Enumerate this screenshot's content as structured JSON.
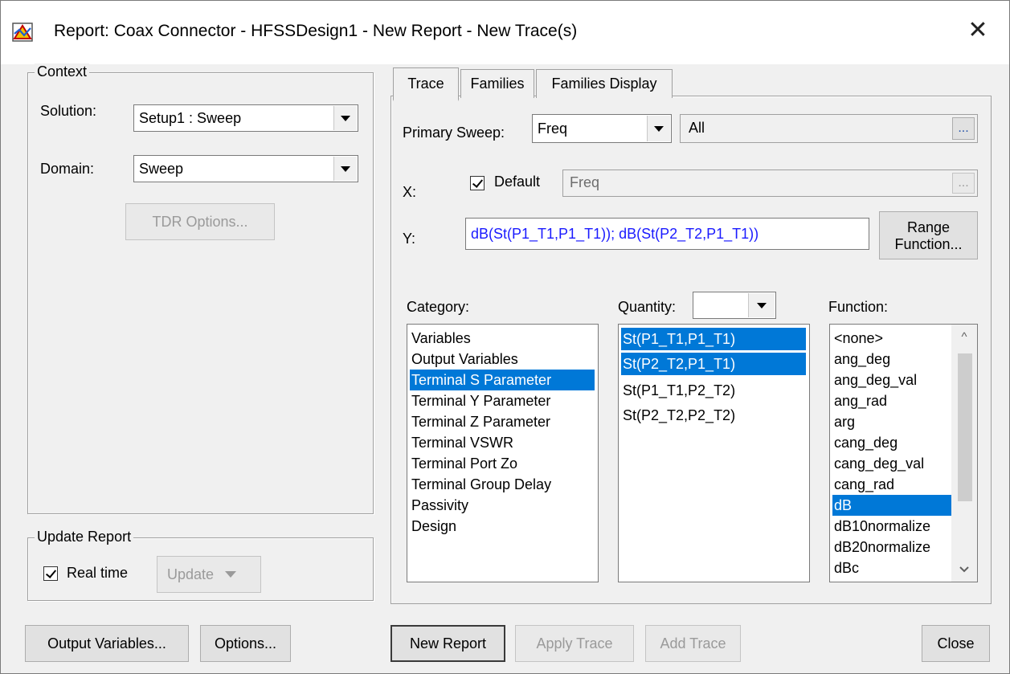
{
  "window": {
    "title": "Report: Coax Connector - HFSSDesign1 - New Report - New Trace(s)",
    "close_glyph": "✕"
  },
  "context": {
    "group_label": "Context",
    "solution_label": "Solution:",
    "solution_value": "Setup1 : Sweep",
    "domain_label": "Domain:",
    "domain_value": "Sweep",
    "tdr_button": "TDR Options..."
  },
  "update_report": {
    "group_label": "Update Report",
    "realtime_label": "Real time",
    "realtime_checked": true,
    "update_button": "Update"
  },
  "tabs": [
    {
      "label": "Trace",
      "active": true
    },
    {
      "label": "Families",
      "active": false
    },
    {
      "label": "Families Display",
      "active": false
    }
  ],
  "trace": {
    "primary_sweep_label": "Primary Sweep:",
    "primary_sweep_value": "Freq",
    "primary_sweep_range": "All",
    "ellipsis": "...",
    "x_label": "X:",
    "default_label": "Default",
    "default_checked": true,
    "x_value": "Freq",
    "y_label": "Y:",
    "y_value": "dB(St(P1_T1,P1_T1)); dB(St(P2_T2,P1_T1))",
    "range_function_line1": "Range",
    "range_function_line2": "Function...",
    "category_label": "Category:",
    "quantity_label": "Quantity:",
    "function_label": "Function:",
    "categories": [
      {
        "text": "Variables",
        "selected": false
      },
      {
        "text": "Output Variables",
        "selected": false
      },
      {
        "text": "Terminal S Parameter",
        "selected": true
      },
      {
        "text": "Terminal Y Parameter",
        "selected": false
      },
      {
        "text": "Terminal Z Parameter",
        "selected": false
      },
      {
        "text": "Terminal VSWR",
        "selected": false
      },
      {
        "text": "Terminal Port Zo",
        "selected": false
      },
      {
        "text": "Terminal Group Delay",
        "selected": false
      },
      {
        "text": "Passivity",
        "selected": false
      },
      {
        "text": "Design",
        "selected": false
      }
    ],
    "quantities": [
      {
        "text": "St(P1_T1,P1_T1)",
        "selected": true
      },
      {
        "text": "St(P2_T2,P1_T1)",
        "selected": true
      },
      {
        "text": "St(P1_T1,P2_T2)",
        "selected": false
      },
      {
        "text": "St(P2_T2,P2_T2)",
        "selected": false
      }
    ],
    "functions": [
      {
        "text": "<none>",
        "selected": false
      },
      {
        "text": "ang_deg",
        "selected": false
      },
      {
        "text": "ang_deg_val",
        "selected": false
      },
      {
        "text": "ang_rad",
        "selected": false
      },
      {
        "text": "arg",
        "selected": false
      },
      {
        "text": "cang_deg",
        "selected": false
      },
      {
        "text": "cang_deg_val",
        "selected": false
      },
      {
        "text": "cang_rad",
        "selected": false
      },
      {
        "text": "dB",
        "selected": true
      },
      {
        "text": "dB10normalize",
        "selected": false
      },
      {
        "text": "dB20normalize",
        "selected": false
      },
      {
        "text": "dBc",
        "selected": false
      }
    ]
  },
  "footer": {
    "output_variables": "Output Variables...",
    "options": "Options...",
    "new_report": "New Report",
    "apply_trace": "Apply Trace",
    "add_trace": "Add Trace",
    "close": "Close"
  },
  "colors": {
    "selection": "#0078d7",
    "y_text": "#1a1aff"
  }
}
